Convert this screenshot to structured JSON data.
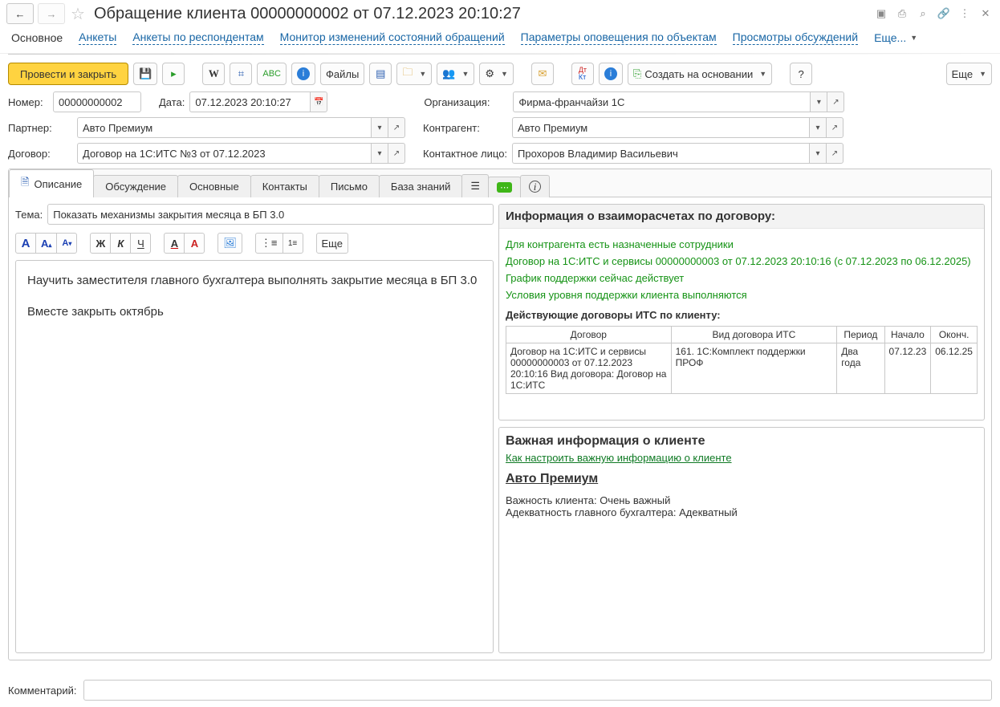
{
  "title": "Обращение клиента 00000000002 от 07.12.2023 20:10:27",
  "nav": {
    "main": "Основное",
    "links": [
      "Анкеты",
      "Анкеты по респондентам",
      "Монитор изменений состояний обращений",
      "Параметры оповещения по объектам",
      "Просмотры обсуждений"
    ],
    "more": "Еще..."
  },
  "toolbar": {
    "post_close": "Провести и закрыть",
    "files": "Файлы",
    "create_based": "Создать на основании",
    "more": "Еще"
  },
  "fields": {
    "number_label": "Номер:",
    "number": "00000000002",
    "date_label": "Дата:",
    "date": "07.12.2023 20:10:27",
    "org_label": "Организация:",
    "org": "Фирма-франчайзи 1С",
    "partner_label": "Партнер:",
    "partner": "Авто Премиум",
    "counterparty_label": "Контрагент:",
    "counterparty": "Авто Премиум",
    "contract_label": "Договор:",
    "contract": "Договор на 1С:ИТС №3 от 07.12.2023",
    "contact_label": "Контактное лицо:",
    "contact": "Прохоров Владимир Васильевич"
  },
  "tabs": [
    "Описание",
    "Обсуждение",
    "Основные",
    "Контакты",
    "Письмо",
    "База знаний"
  ],
  "topic_label": "Тема:",
  "topic": "Показать механизмы закрытия месяца в БП 3.0",
  "editor_more": "Еще",
  "editor_body_p1": "Научить заместителя главного бухгалтера выполнять закрытие месяца в БП 3.0",
  "editor_body_p2": "Вместе закрыть октябрь",
  "settlements": {
    "title": "Информация о взаиморасчетах по договору:",
    "line1": "Для контрагента есть назначенные сотрудники",
    "line2": "Договор на 1С:ИТС и сервисы 00000000003 от 07.12.2023 20:10:16 (с 07.12.2023 по 06.12.2025)",
    "line3": "График поддержки сейчас действует",
    "line4": "Условия уровня поддержки клиента выполняются",
    "subtitle": "Действующие договоры ИТС по клиенту:",
    "table": {
      "headers": [
        "Договор",
        "Вид договора ИТС",
        "Период",
        "Начало",
        "Оконч."
      ],
      "row": {
        "c1": "Договор на 1С:ИТС и сервисы 00000000003 от 07.12.2023 20:10:16 Вид договора: Договор на 1С:ИТС",
        "c2": "161. 1С:Комплект поддержки ПРОФ",
        "c3": "Два года",
        "c4": "07.12.23",
        "c5": "06.12.25"
      }
    }
  },
  "client_info": {
    "title": "Важная информация о клиенте",
    "config_link": "Как настроить важную информацию о клиенте",
    "client": "Авто Премиум",
    "line1": "Важность клиента: Очень важный",
    "line2": "Адекватность главного бухгалтера: Адекватный"
  },
  "comment_label": "Комментарий:"
}
